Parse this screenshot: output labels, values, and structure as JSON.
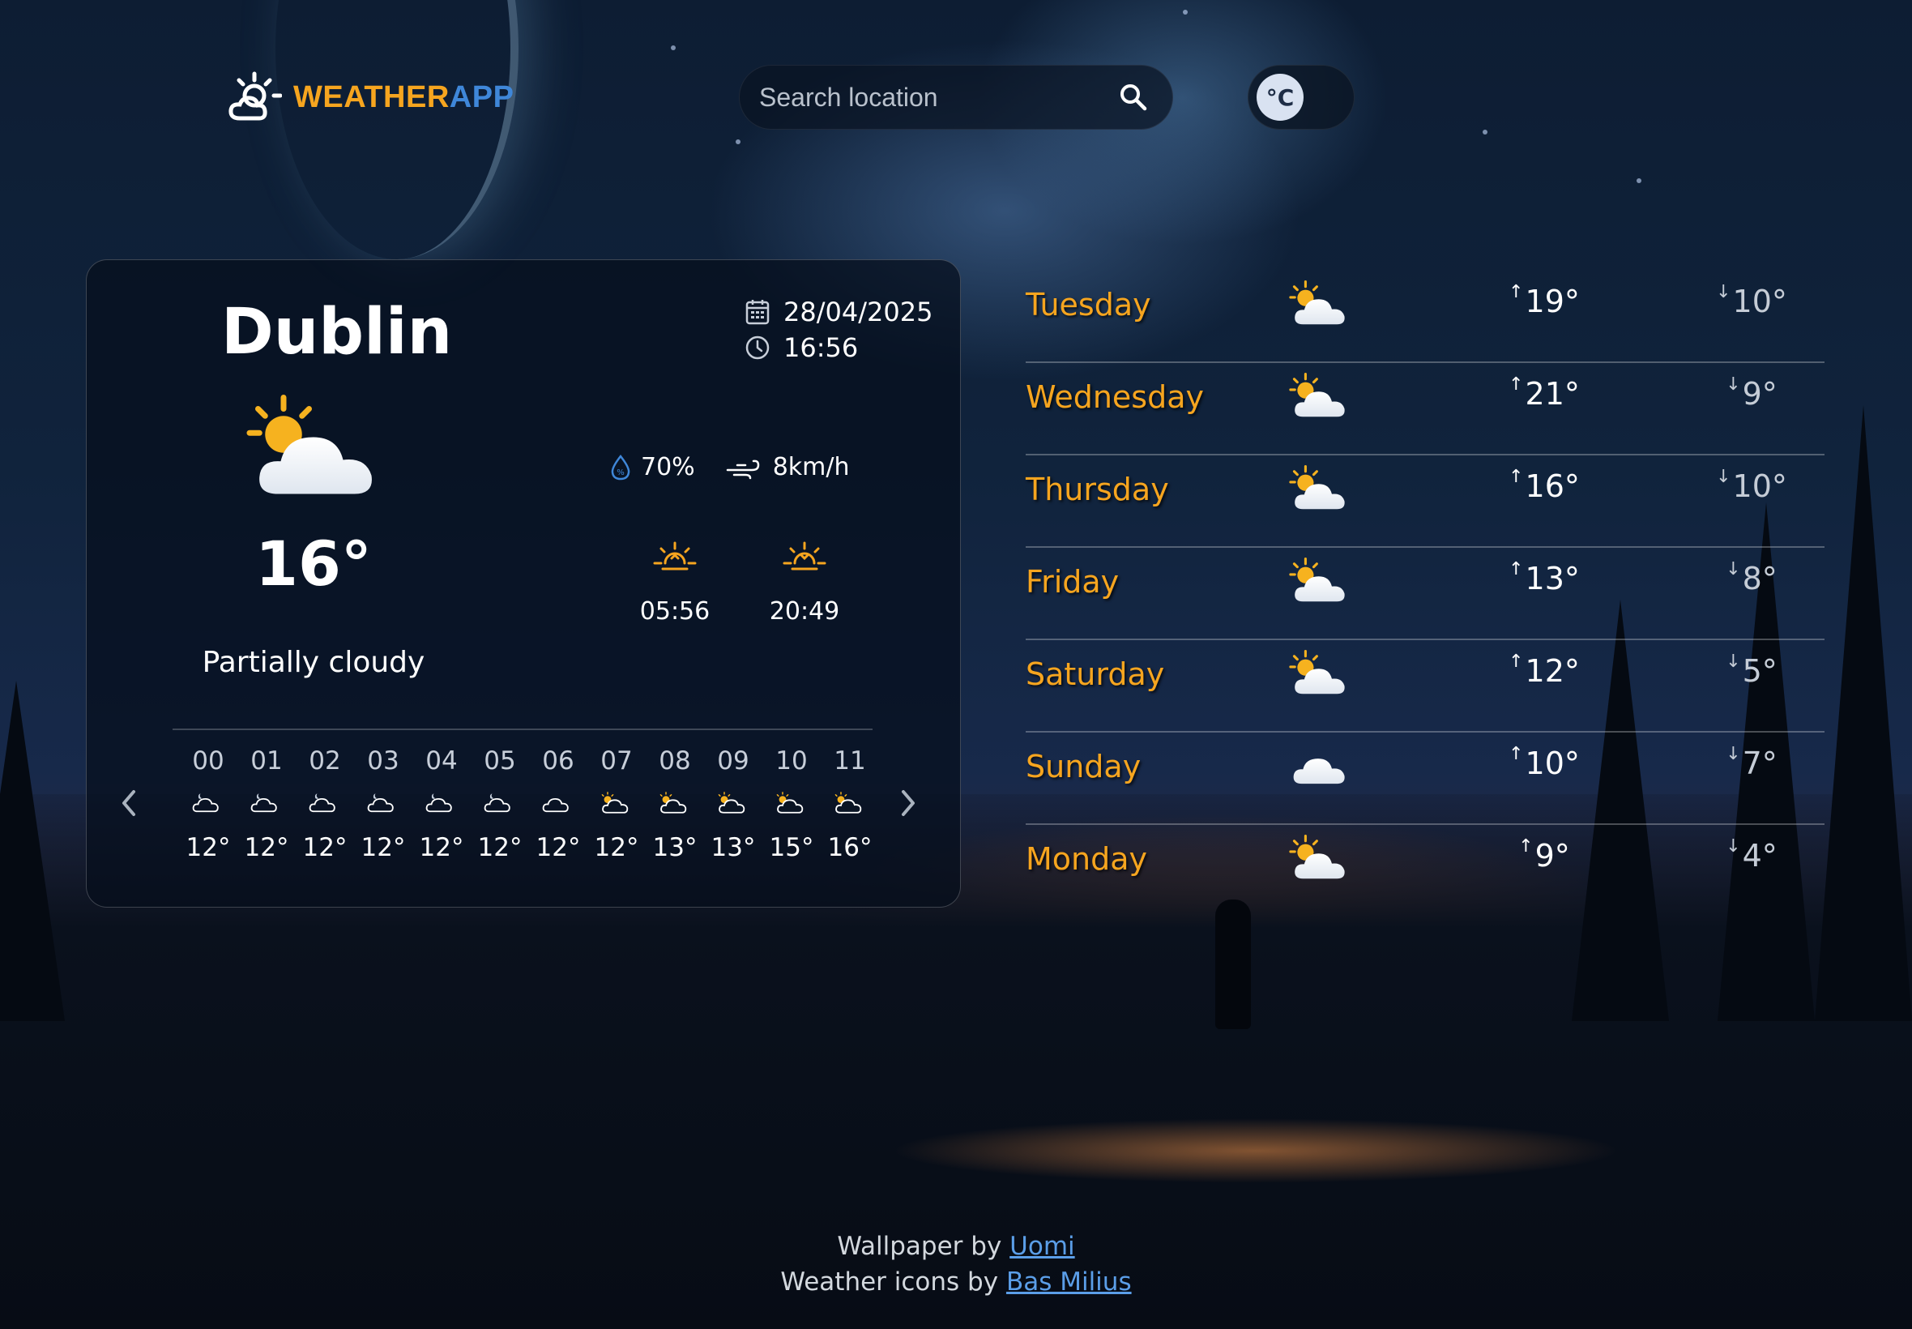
{
  "header": {
    "logo_part1": "WEATHER",
    "logo_part2": "APP",
    "search_placeholder": "Search location",
    "unit_label": "°C"
  },
  "current": {
    "city": "Dublin",
    "date": "28/04/2025",
    "time": "16:56",
    "temperature": "16°",
    "condition": "Partially cloudy",
    "humidity": "70%",
    "wind": "8km/h",
    "sunrise": "05:56",
    "sunset": "20:49"
  },
  "hourly": [
    {
      "hour": "00",
      "temp": "12°",
      "icon": "cloud-night-icon"
    },
    {
      "hour": "01",
      "temp": "12°",
      "icon": "cloud-night-icon"
    },
    {
      "hour": "02",
      "temp": "12°",
      "icon": "cloud-night-icon"
    },
    {
      "hour": "03",
      "temp": "12°",
      "icon": "cloud-night-icon"
    },
    {
      "hour": "04",
      "temp": "12°",
      "icon": "cloud-night-icon"
    },
    {
      "hour": "05",
      "temp": "12°",
      "icon": "cloud-night-icon"
    },
    {
      "hour": "06",
      "temp": "12°",
      "icon": "cloud-icon"
    },
    {
      "hour": "07",
      "temp": "12°",
      "icon": "partly-cloudy-day-icon"
    },
    {
      "hour": "08",
      "temp": "13°",
      "icon": "partly-cloudy-day-icon"
    },
    {
      "hour": "09",
      "temp": "13°",
      "icon": "partly-cloudy-day-icon"
    },
    {
      "hour": "10",
      "temp": "15°",
      "icon": "partly-cloudy-day-icon"
    },
    {
      "hour": "11",
      "temp": "16°",
      "icon": "partly-cloudy-day-icon"
    }
  ],
  "daily": [
    {
      "day": "Tuesday",
      "high": "19°",
      "low": "10°",
      "icon": "partly-cloudy-day-icon"
    },
    {
      "day": "Wednesday",
      "high": "21°",
      "low": "9°",
      "icon": "partly-cloudy-day-icon"
    },
    {
      "day": "Thursday",
      "high": "16°",
      "low": "10°",
      "icon": "partly-cloudy-day-icon"
    },
    {
      "day": "Friday",
      "high": "13°",
      "low": "8°",
      "icon": "partly-cloudy-day-icon"
    },
    {
      "day": "Saturday",
      "high": "12°",
      "low": "5°",
      "icon": "partly-cloudy-day-icon"
    },
    {
      "day": "Sunday",
      "high": "10°",
      "low": "7°",
      "icon": "cloud-icon"
    },
    {
      "day": "Monday",
      "high": "9°",
      "low": "4°",
      "icon": "partly-cloudy-day-icon"
    }
  ],
  "footer": {
    "wallpaper_prefix": "Wallpaper by",
    "wallpaper_author": "Uomi",
    "icons_prefix": "Weather icons by",
    "icons_author": "Bas Milius"
  },
  "colors": {
    "accent_orange": "#f6a51f",
    "accent_blue": "#3f87d9",
    "link": "#5b9ee8"
  }
}
